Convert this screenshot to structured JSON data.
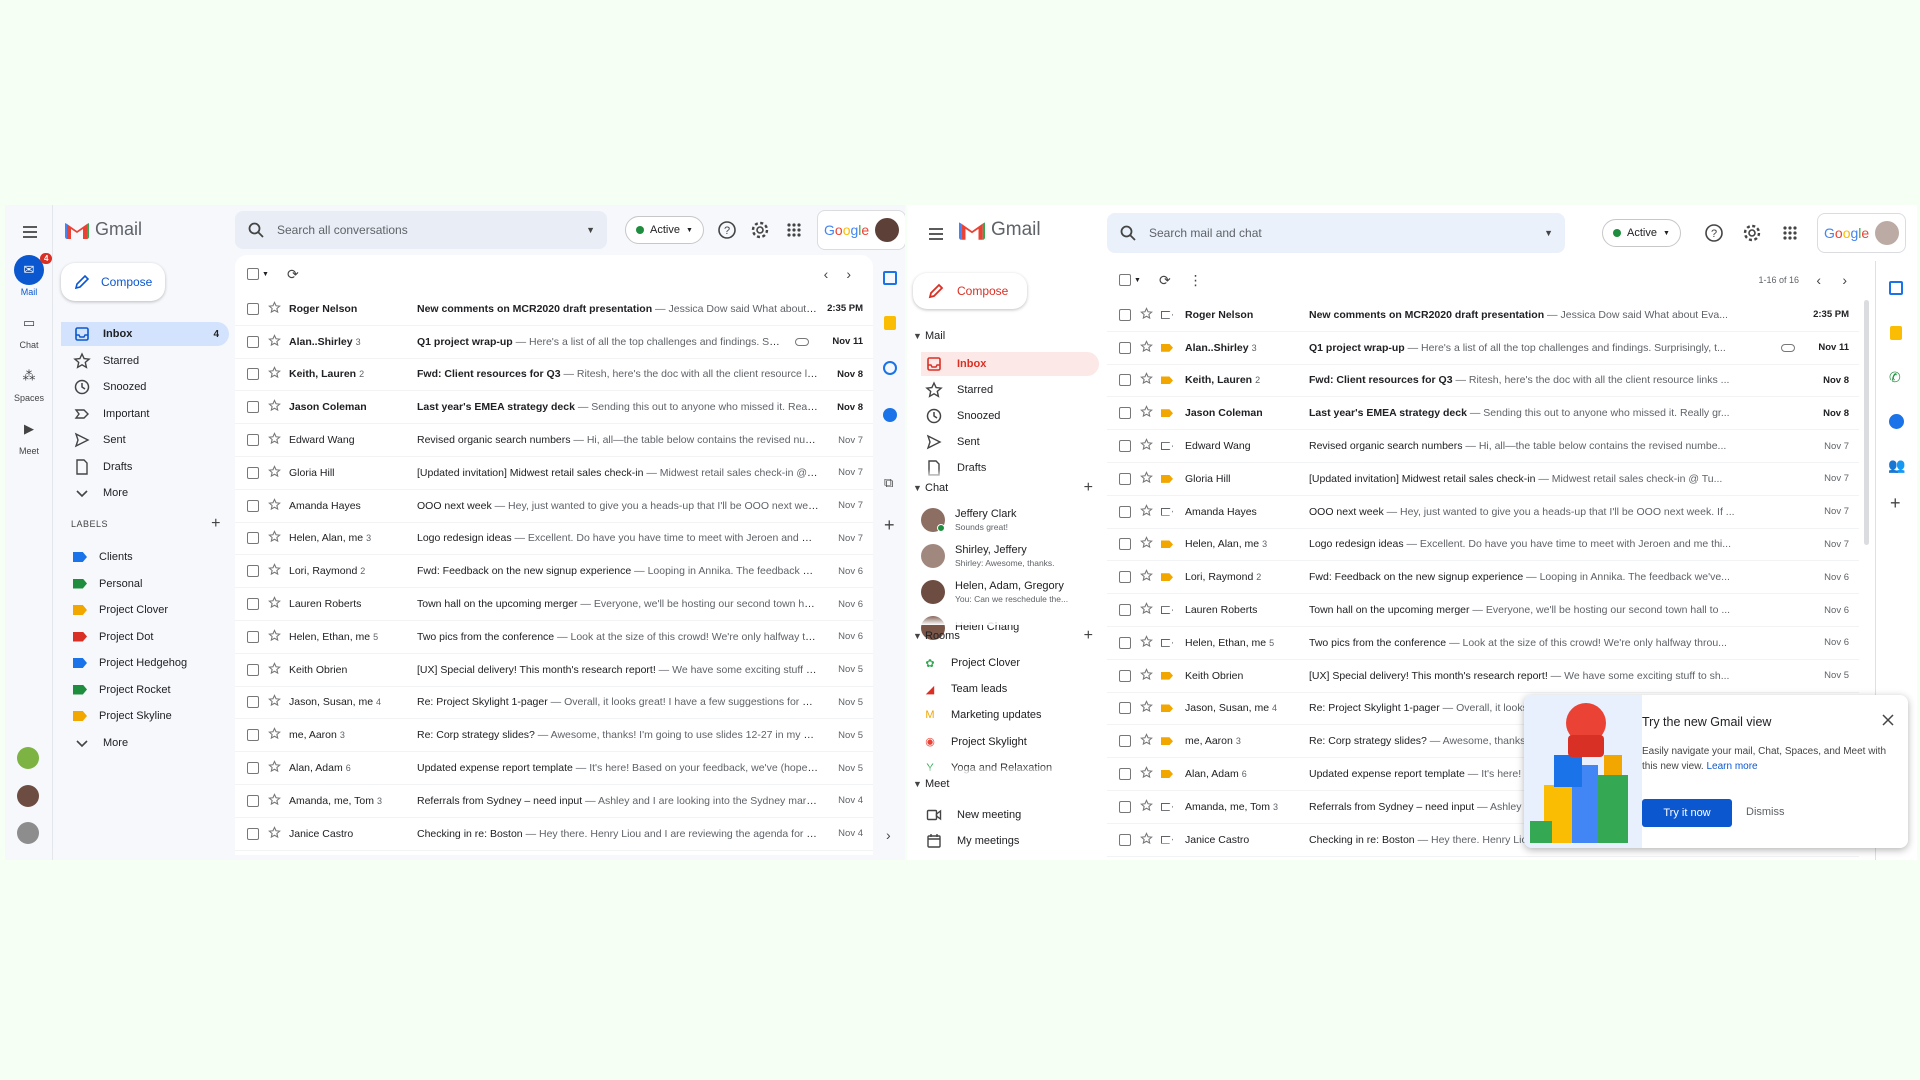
{
  "colors": {
    "page_bg": "#f5fff3",
    "accent_blue": "#0b57d0",
    "gmail_red": "#ea4335",
    "active_green": "#1e8e3e",
    "important_yellow": "#f2a600"
  },
  "left": {
    "app_name": "Gmail",
    "search_placeholder": "Search all conversations",
    "status": "Active",
    "brand": "Google",
    "rail": [
      {
        "label": "Mail",
        "badge": "4"
      },
      {
        "label": "Chat"
      },
      {
        "label": "Spaces"
      },
      {
        "label": "Meet"
      }
    ],
    "compose": "Compose",
    "nav": [
      {
        "label": "Inbox",
        "count": "4",
        "icon": "inbox-icon"
      },
      {
        "label": "Starred",
        "icon": "star-icon"
      },
      {
        "label": "Snoozed",
        "icon": "clock-icon"
      },
      {
        "label": "Important",
        "icon": "important-icon"
      },
      {
        "label": "Sent",
        "icon": "send-icon"
      },
      {
        "label": "Drafts",
        "icon": "draft-icon"
      },
      {
        "label": "More",
        "icon": "chevron-down-icon"
      }
    ],
    "labels_header": "LABELS",
    "labels": [
      {
        "label": "Clients",
        "color": "#1a73e8"
      },
      {
        "label": "Personal",
        "color": "#1e8e3e"
      },
      {
        "label": "Project Clover",
        "color": "#f2a600"
      },
      {
        "label": "Project Dot",
        "color": "#d93025"
      },
      {
        "label": "Project Hedgehog",
        "color": "#1a73e8"
      },
      {
        "label": "Project Rocket",
        "color": "#1e8e3e"
      },
      {
        "label": "Project Skyline",
        "color": "#f2a600"
      }
    ],
    "labels_more": "More"
  },
  "right": {
    "app_name": "Gmail",
    "search_placeholder": "Search mail and chat",
    "status": "Active",
    "brand": "Google",
    "compose": "Compose",
    "pager": "1-16 of 16",
    "mail_header": "Mail",
    "mail_nav": [
      {
        "label": "Inbox",
        "icon": "inbox-icon"
      },
      {
        "label": "Starred",
        "icon": "star-icon"
      },
      {
        "label": "Snoozed",
        "icon": "clock-icon"
      },
      {
        "label": "Sent",
        "icon": "send-icon"
      },
      {
        "label": "Drafts",
        "icon": "draft-icon"
      }
    ],
    "chat_header": "Chat",
    "chats": [
      {
        "name": "Jeffery Clark",
        "sub": "Sounds great!",
        "color": "#8d6e63"
      },
      {
        "name": "Shirley, Jeffery",
        "sub": "Shirley: Awesome, thanks.",
        "color": "#a1887f"
      },
      {
        "name": "Helen, Adam, Gregory",
        "sub": "You: Can we reschedule the...",
        "color": "#6d4c41"
      },
      {
        "name": "Helen Chang",
        "sub": "",
        "color": "#795548"
      }
    ],
    "rooms_header": "Rooms",
    "rooms": [
      {
        "name": "Project Clover",
        "glyph": "✿",
        "color": "#34a853"
      },
      {
        "name": "Team leads",
        "glyph": "◢",
        "color": "#d93025"
      },
      {
        "name": "Marketing updates",
        "glyph": "M",
        "color": "#f2a600"
      },
      {
        "name": "Project Skylight",
        "glyph": "◉",
        "color": "#ea4335"
      },
      {
        "name": "Yoga and Relaxation",
        "glyph": "Y",
        "color": "#34a853"
      }
    ],
    "meet_header": "Meet",
    "meet": [
      {
        "label": "New meeting",
        "icon": "video-icon"
      },
      {
        "label": "My meetings",
        "icon": "calendar-icon"
      }
    ]
  },
  "emails": [
    {
      "sender": "Roger Nelson",
      "count": "",
      "subject": "New comments on MCR2020 draft presentation",
      "snippet": "Jessica Dow said What about Eva...",
      "date": "2:35 PM",
      "unread": true,
      "attach": false,
      "important": false
    },
    {
      "sender": "Alan..Shirley",
      "count": "3",
      "subject": "Q1 project wrap-up",
      "snippet": "Here's a list of all the top challenges and findings. Surprisingly, t...",
      "date": "Nov 11",
      "unread": true,
      "attach": true,
      "important": true
    },
    {
      "sender": "Keith, Lauren",
      "count": "2",
      "subject": "Fwd: Client resources for Q3",
      "snippet": "Ritesh, here's the doc with all the client resource links ...",
      "date": "Nov 8",
      "unread": true,
      "attach": false,
      "important": true
    },
    {
      "sender": "Jason Coleman",
      "count": "",
      "subject": "Last year's EMEA strategy deck",
      "snippet": "Sending this out to anyone who missed it. Really gr...",
      "date": "Nov 8",
      "unread": true,
      "attach": false,
      "important": true
    },
    {
      "sender": "Edward Wang",
      "count": "",
      "subject": "Revised organic search numbers",
      "snippet": "Hi, all—the table below contains the revised numbe...",
      "date": "Nov 7",
      "unread": false,
      "attach": false,
      "important": false
    },
    {
      "sender": "Gloria Hill",
      "count": "",
      "subject": "[Updated invitation] Midwest retail sales check-in",
      "snippet": "Midwest retail sales check-in @ Tu...",
      "date": "Nov 7",
      "unread": false,
      "attach": false,
      "important": true
    },
    {
      "sender": "Amanda Hayes",
      "count": "",
      "subject": "OOO next week",
      "snippet": "Hey, just wanted to give you a heads-up that I'll be OOO next week. If ...",
      "date": "Nov 7",
      "unread": false,
      "attach": false,
      "important": false
    },
    {
      "sender": "Helen, Alan, me",
      "count": "3",
      "subject": "Logo redesign ideas",
      "snippet": "Excellent. Do have you have time to meet with Jeroen and me thi...",
      "date": "Nov 7",
      "unread": false,
      "attach": false,
      "important": true
    },
    {
      "sender": "Lori, Raymond",
      "count": "2",
      "subject": "Fwd: Feedback on the new signup experience",
      "snippet": "Looping in Annika. The feedback we've...",
      "date": "Nov 6",
      "unread": false,
      "attach": false,
      "important": true
    },
    {
      "sender": "Lauren Roberts",
      "count": "",
      "subject": "Town hall on the upcoming merger",
      "snippet": "Everyone, we'll be hosting our second town hall to ...",
      "date": "Nov 6",
      "unread": false,
      "attach": false,
      "important": false
    },
    {
      "sender": "Helen, Ethan, me",
      "count": "5",
      "subject": "Two pics from the conference",
      "snippet": "Look at the size of this crowd! We're only halfway throu...",
      "date": "Nov 6",
      "unread": false,
      "attach": false,
      "important": false
    },
    {
      "sender": "Keith Obrien",
      "count": "",
      "subject": "[UX] Special delivery! This month's research report!",
      "snippet": "We have some exciting stuff to sh...",
      "date": "Nov 5",
      "unread": false,
      "attach": false,
      "important": true
    },
    {
      "sender": "Jason, Susan, me",
      "count": "4",
      "subject": "Re: Project Skylight 1-pager",
      "snippet": "Overall, it looks great! I have a few suggestions for what t...",
      "date": "Nov 5",
      "unread": false,
      "attach": false,
      "important": true
    },
    {
      "sender": "me, Aaron",
      "count": "3",
      "subject": "Re: Corp strategy slides?",
      "snippet": "Awesome, thanks! I'm going to use slides 12-27 in my presen...",
      "date": "Nov 5",
      "unread": false,
      "attach": false,
      "important": true
    },
    {
      "sender": "Alan, Adam",
      "count": "6",
      "subject": "Updated expense report template",
      "snippet": "It's here! Based on your feedback, we've (hopefully)...",
      "date": "Nov 5",
      "unread": false,
      "attach": false,
      "important": true
    },
    {
      "sender": "Amanda, me, Tom",
      "count": "3",
      "subject": "Referrals from Sydney – need input",
      "snippet": "Ashley and I are looking into the Sydney market, a...",
      "date": "Nov 4",
      "unread": false,
      "attach": false,
      "important": false
    },
    {
      "sender": "Janice Castro",
      "count": "",
      "subject": "Checking in re: Boston",
      "snippet": "Hey there. Henry Liou and I are reviewing the agenda for Boston...",
      "date": "Nov 4",
      "unread": false,
      "attach": false,
      "important": false
    }
  ],
  "promo": {
    "title": "Try the new Gmail view",
    "body": "Easily navigate your mail, Chat, Spaces, and Meet with this new view.",
    "link": "Learn more",
    "primary": "Try it now",
    "secondary": "Dismiss"
  }
}
